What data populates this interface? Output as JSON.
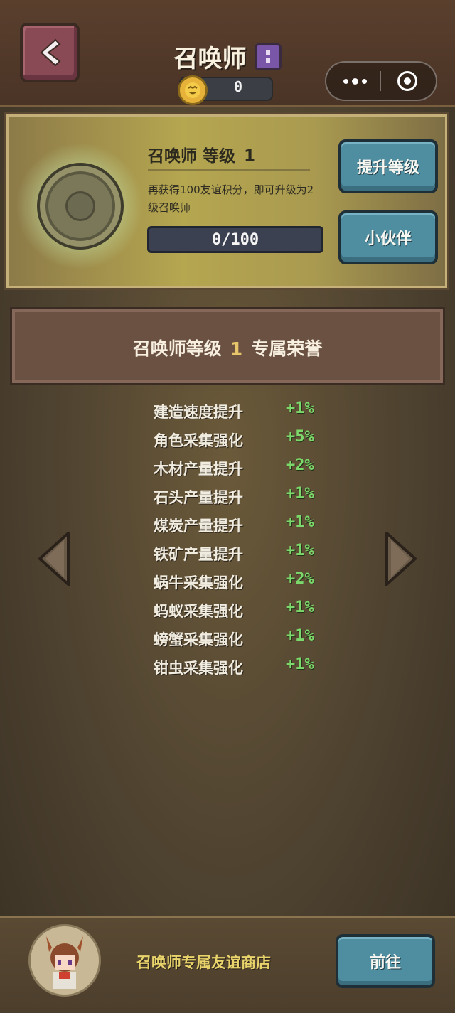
{
  "header": {
    "title": "召唤师",
    "coins": "0"
  },
  "level_panel": {
    "title": "召唤师 等级",
    "level": "1",
    "description": "再获得100友谊积分，即可升级为2级召唤师",
    "progress_text": "0/100",
    "progress_fraction": 0,
    "upgrade_button": "提升等级",
    "partner_button": "小伙伴"
  },
  "banner": {
    "prefix": "召唤师等级",
    "level": "1",
    "suffix": "专属荣誉"
  },
  "bonuses": [
    {
      "label": "建造速度提升",
      "value": "+1%"
    },
    {
      "label": "角色采集强化",
      "value": "+5%"
    },
    {
      "label": "木材产量提升",
      "value": "+2%"
    },
    {
      "label": "石头产量提升",
      "value": "+1%"
    },
    {
      "label": "煤炭产量提升",
      "value": "+1%"
    },
    {
      "label": "铁矿产量提升",
      "value": "+1%"
    },
    {
      "label": "蜗牛采集强化",
      "value": "+2%"
    },
    {
      "label": "蚂蚁采集强化",
      "value": "+1%"
    },
    {
      "label": "螃蟹采集强化",
      "value": "+1%"
    },
    {
      "label": "钳虫采集强化",
      "value": "+1%"
    }
  ],
  "footer": {
    "shop_label": "召唤师专属友谊商店",
    "go_button": "前往"
  },
  "icons": {
    "back": "chevron-left-icon",
    "info": "info-icon",
    "coin": "coin-icon",
    "more": "more-dots-icon",
    "target": "target-icon",
    "prev": "arrow-left-icon",
    "next": "arrow-right-icon"
  },
  "colors": {
    "accent_green": "#7bd86a",
    "button_teal": "#4f8ea0",
    "gold_text": "#e9d46c"
  }
}
